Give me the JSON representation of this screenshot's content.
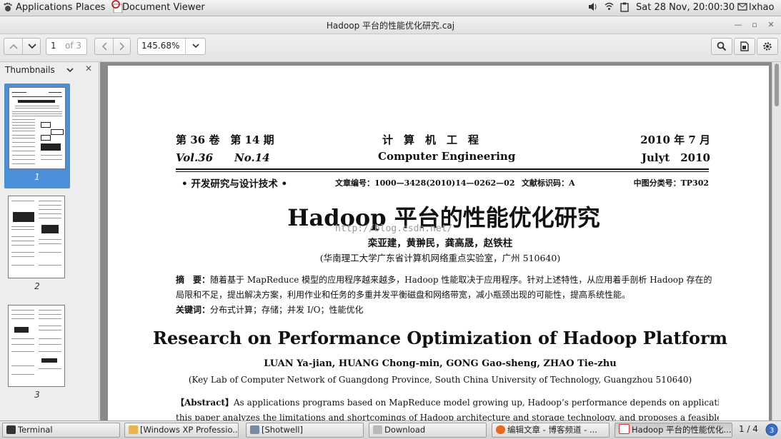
{
  "top_panel": {
    "applications": "Applications",
    "places": "Places",
    "app_name": "Document Viewer",
    "datetime": "Sat 28 Nov, 20:00:30",
    "user": "lxhao"
  },
  "window": {
    "title": "Hadoop 平台的性能优化研究.caj"
  },
  "toolbar": {
    "page_value": "1",
    "page_of": "of 3",
    "zoom": "145.68%"
  },
  "sidebar": {
    "title": "Thumbnails",
    "thumbnails": [
      {
        "label": "1"
      },
      {
        "label": "2"
      },
      {
        "label": "3"
      }
    ]
  },
  "document": {
    "header_left_cn": "第 36 卷　第 14 期",
    "header_left_en": "Vol.36　　No.14",
    "header_center_cn": "计　算　机　工　程",
    "header_center_en": "Computer Engineering",
    "header_right_cn": "2010 年 7 月",
    "header_right_en": "Julyt　2010",
    "section": "• 开发研究与设计技术 •",
    "article_no": "文章编号：1000—3428(2010)14—0262—02",
    "doc_code": "文献标识码：A",
    "class_no": "中图分类号：TP302",
    "title_cn": "Hadoop 平台的性能优化研究",
    "watermark": "http://blog.csdn.net/",
    "authors_cn": "栾亚建，黄翀民，龚高晟，赵铁柱",
    "affil_cn": "(华南理工大学广东省计算机网络重点实验室，广州 510640)",
    "abstract_label_cn": "摘　要：",
    "abstract_cn_1": "随着基于 MapReduce 模型的应用程序越来越多，Hadoop 性能取决于应用程序。针对上述特性，从应用着手剖析 Hadoop 存在的",
    "abstract_cn_2": "局限和不足，提出解决方案，利用作业和任务的多重并发平衡磁盘和网络带宽，减小瓶颈出现的可能性，提高系统性能。",
    "keywords_label_cn": "关键词：",
    "keywords_cn": "分布式计算；存储；并发 I/O；性能优化",
    "title_en": "Research on Performance Optimization of Hadoop Platform",
    "authors_en": "LUAN Ya-jian, HUANG Chong-min, GONG Gao-sheng, ZHAO Tie-zhu",
    "affil_en": "(Key Lab of Computer Network of Guangdong Province, South China University of Technology, Guangzhou 510640)",
    "abstract_label_en": "【Abstract】",
    "abstract_en_1": "As applications programs based on MapReduce model growing up, Hadoop’s performance depends on applications. From applications,",
    "abstract_en_2": "this paper analyzes the limitations and shortcomings of Hadoop architecture and storage technology, and proposes a feasible and cost-effective"
  },
  "taskbar": {
    "items": [
      {
        "label": "Terminal"
      },
      {
        "label": "[Windows XP Professio..."
      },
      {
        "label": "[Shotwell]"
      },
      {
        "label": "Download"
      },
      {
        "label": "编辑文章 - 博客频道 - ..."
      },
      {
        "label": "Hadoop 平台的性能优化..."
      }
    ],
    "workspace": "1 / 4"
  },
  "icons": {
    "applications": "gnome-foot-icon",
    "app": "document-viewer-icon",
    "volume": "speaker-icon",
    "network": "wifi-icon",
    "clipboard": "clipboard-icon",
    "user": "user-mail-icon"
  },
  "colors": {
    "selection": "#4a90d9",
    "page_bg": "#8a8a8a"
  }
}
